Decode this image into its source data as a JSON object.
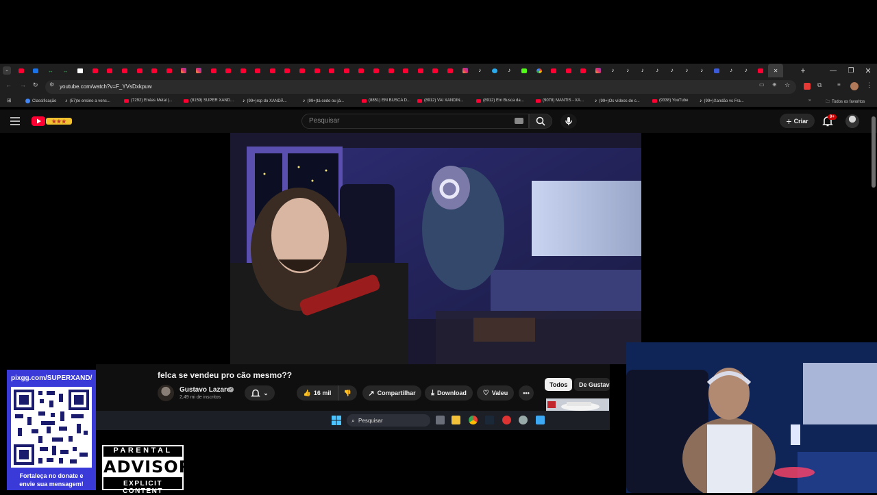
{
  "browser": {
    "url": "youtube.com/watch?v=F_YVsDxkpuw",
    "tabs": [
      "yt",
      "ch",
      "gr",
      "gr",
      "wt",
      "yt",
      "yt",
      "yt",
      "yt",
      "yt",
      "yt",
      "ig",
      "ig",
      "yt",
      "yt",
      "yt",
      "yt",
      "yt",
      "yt",
      "yt",
      "yt",
      "yt",
      "yt",
      "yt",
      "yt",
      "yt",
      "yt",
      "yt",
      "yt",
      "yt",
      "ig",
      "tt",
      "tg",
      "tt",
      "kk",
      "gg",
      "yt",
      "yt",
      "yt",
      "ig",
      "tt",
      "tt",
      "tt",
      "tt",
      "tt",
      "tt",
      "tt",
      "bl",
      "tt",
      "tt",
      "yt",
      "active"
    ],
    "bookmarks": [
      {
        "label": "Classificação",
        "icon": "g"
      },
      {
        "label": "(57)te ensino a venc...",
        "icon": "tt"
      },
      {
        "label": "(7292) Enéas Metal |...",
        "icon": "yt"
      },
      {
        "label": "(8159) SUPER XAND...",
        "icon": "yt"
      },
      {
        "label": "(99+)rsp do XANDÃ...",
        "icon": "tt"
      },
      {
        "label": "(99+)tá cedo ou já...",
        "icon": "tt"
      },
      {
        "label": "(8851) EM BUSCA D...",
        "icon": "yt"
      },
      {
        "label": "(8912) VAI XANDIN...",
        "icon": "yt"
      },
      {
        "label": "(8912) Em Busca da...",
        "icon": "yt"
      },
      {
        "label": "(9078) MANTIS - XA...",
        "icon": "yt"
      },
      {
        "label": "(99+)Os vídeos de c...",
        "icon": "tt"
      },
      {
        "label": "(9338) YouTube",
        "icon": "yt"
      },
      {
        "label": "(99+)Xandão vs Fra...",
        "icon": "tt"
      }
    ],
    "bookmarks_folder": "Todos os favoritos"
  },
  "youtube": {
    "search_placeholder": "Pesquisar",
    "create_label": "Criar",
    "notifications_badge": "9+",
    "video": {
      "title": "felca se vendeu pro cão mesmo??",
      "channel": "Gustavo Lazaro",
      "subscribers": "2,49 mi de inscritos",
      "likes": "16 mil",
      "share_label": "Compartilhar",
      "download_label": "Download",
      "thanks_label": "Valeu"
    },
    "chips": [
      "Todos",
      "De Gustavo"
    ]
  },
  "taskbar": {
    "search_label": "Pesquisar"
  },
  "overlay": {
    "donate_url": "pixgg.com/SUPERXAND/",
    "donate_message_line1": "Fortaleça no donate e",
    "donate_message_line2": "envie sua mensagem!",
    "advisory_top": "PARENTAL",
    "advisory_mid": "ADVISORY",
    "advisory_bottom": "EXPLICIT CONTENT"
  },
  "colors": {
    "youtube_red": "#ff0033",
    "donate_bg": "#3a3ad8",
    "background": "#0f0f0f"
  }
}
